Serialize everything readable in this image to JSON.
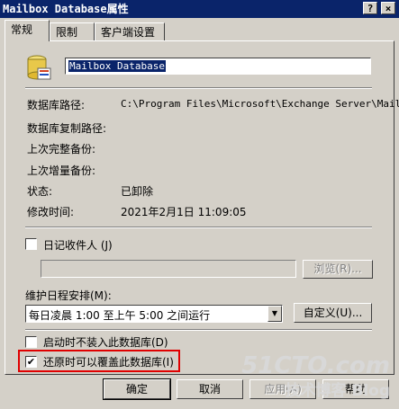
{
  "window": {
    "title": "Mailbox Database属性",
    "help_glyph": "?",
    "close_glyph": "×"
  },
  "tabs": [
    {
      "label": "常规"
    },
    {
      "label": "限制"
    },
    {
      "label": "客户端设置"
    }
  ],
  "general": {
    "name_value": "Mailbox Database",
    "fields": [
      {
        "label": "数据库路径:",
        "value": "C:\\Program Files\\Microsoft\\Exchange Server\\Mail"
      },
      {
        "label": "数据库复制路径:",
        "value": ""
      },
      {
        "label": "上次完整备份:",
        "value": ""
      },
      {
        "label": "上次增量备份:",
        "value": ""
      },
      {
        "label": "状态:",
        "value": "已卸除"
      },
      {
        "label": "修改时间:",
        "value": "2021年2月1日 11:09:05"
      }
    ],
    "journal_label": "日记收件人 (J)",
    "browse_label": "浏览(R)...",
    "maint_label": "维护日程安排(M):",
    "maint_value": "每日凌晨 1:00 至上午 5:00 之间运行",
    "customize_label": "自定义(U)...",
    "no_mount_label": "启动时不装入此数据库(D)",
    "restore_label": "还原时可以覆盖此数据库(I)",
    "journal_checked": false,
    "no_mount_checked": false,
    "restore_checked": true,
    "restore_highlight_color": "#e00000"
  },
  "footer": {
    "ok": "确定",
    "cancel": "取消",
    "apply": "应用(A)",
    "help": "帮助"
  },
  "watermark": {
    "line1": "51CTO.com",
    "line2": "技术博客 Blog"
  }
}
